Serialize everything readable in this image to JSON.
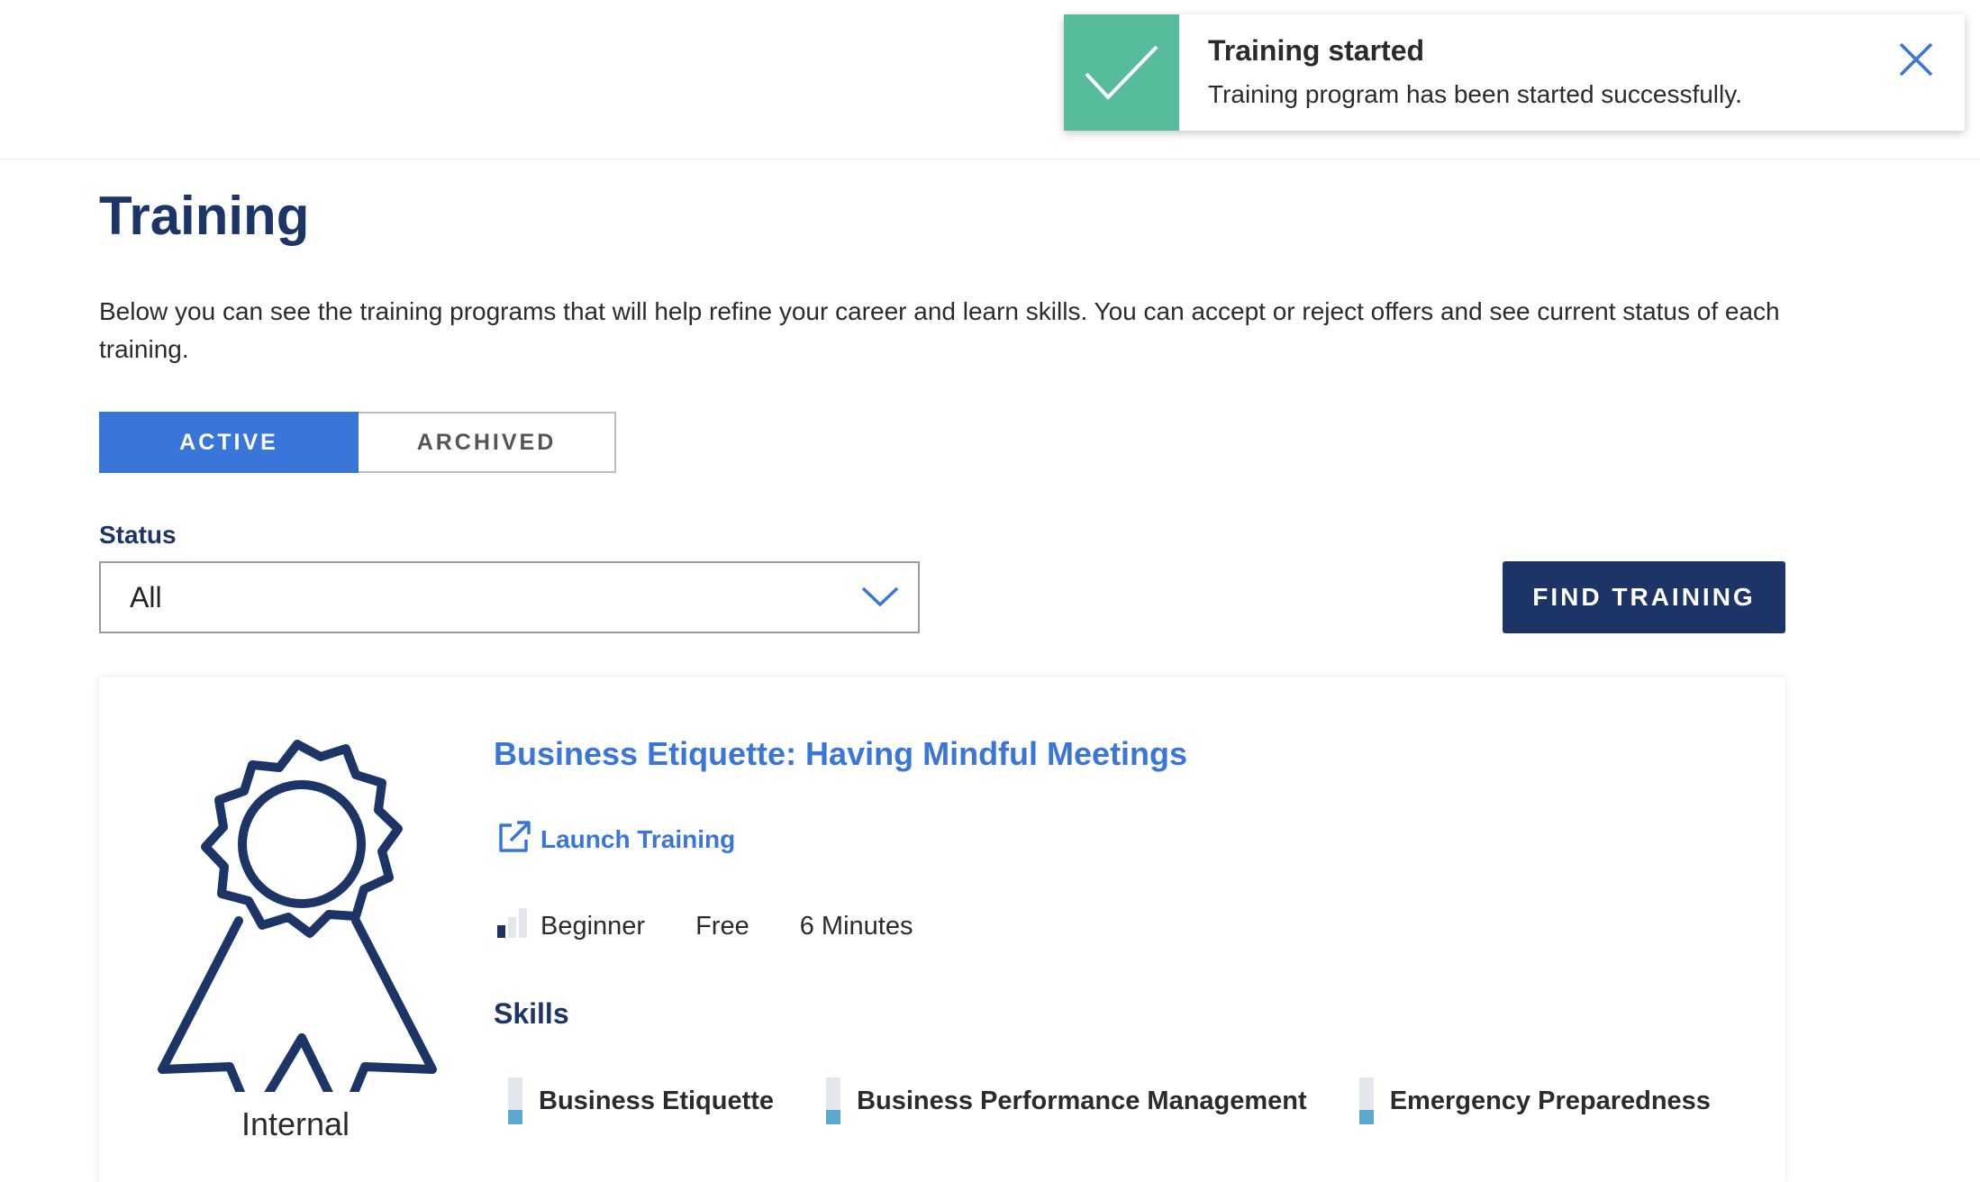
{
  "toast": {
    "title": "Training started",
    "message": "Training program has been started successfully.",
    "accent": "#56bc9c"
  },
  "page": {
    "title": "Training",
    "intro": "Below you can see the training programs that will help refine your career and learn skills. You can accept or reject offers and see current status of each training."
  },
  "tabs": [
    {
      "label": "ACTIVE",
      "active": true
    },
    {
      "label": "ARCHIVED",
      "active": false
    }
  ],
  "filter": {
    "label": "Status",
    "value": "All"
  },
  "find_button": {
    "label": "FIND TRAINING"
  },
  "course": {
    "provider": "Internal",
    "title": "Business Etiquette: Having Mindful Meetings",
    "launch_label": "Launch Training",
    "level": "Beginner",
    "price": "Free",
    "duration": "6 Minutes",
    "skills_heading": "Skills",
    "skills": [
      "Business Etiquette",
      "Business Performance Management",
      "Emergency Preparedness"
    ]
  },
  "colors": {
    "primary_dark": "#1c3566",
    "primary": "#3a76da",
    "success": "#56bc9c"
  }
}
